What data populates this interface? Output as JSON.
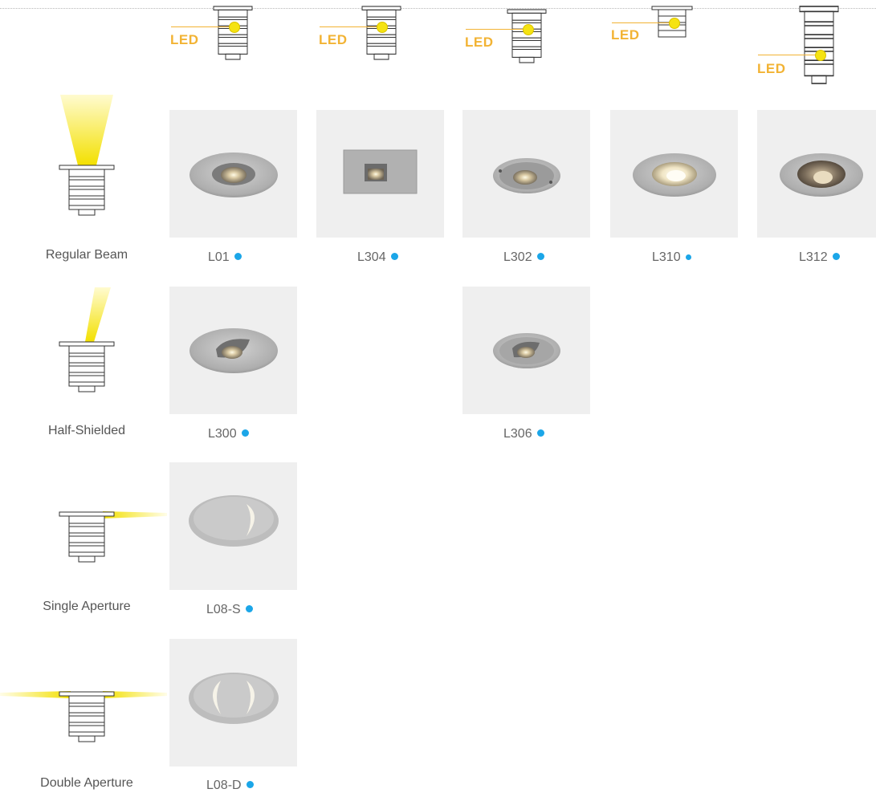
{
  "colors": {
    "led_accent": "#f2b334",
    "led_dot": "#f5e312",
    "status_dot": "#1ba6e8",
    "tile_bg": "#efefef"
  },
  "led_label": "LED",
  "top_fixtures": [
    {
      "name": "fixture-1",
      "led": "LED"
    },
    {
      "name": "fixture-2",
      "led": "LED"
    },
    {
      "name": "fixture-3",
      "led": "LED"
    },
    {
      "name": "fixture-4",
      "led": "LED"
    },
    {
      "name": "fixture-5",
      "led": "LED"
    }
  ],
  "rows": [
    {
      "type": "Regular Beam",
      "products": [
        "L01",
        "L304",
        "L302",
        "L310",
        "L312"
      ]
    },
    {
      "type": "Half-Shielded",
      "products": [
        "L300",
        "L306"
      ]
    },
    {
      "type": "Single Aperture",
      "products": [
        "L08-S"
      ]
    },
    {
      "type": "Double Aperture",
      "products": [
        "L08-D"
      ]
    }
  ]
}
